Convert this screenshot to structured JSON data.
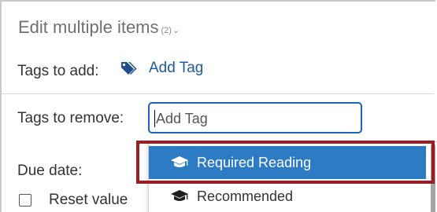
{
  "header": {
    "title": "Edit multiple items",
    "count_label": "(2)"
  },
  "tags_add": {
    "label": "Tags to add:",
    "link_label": "Add Tag",
    "icon": "tag-icon"
  },
  "tags_remove": {
    "label": "Tags to remove:",
    "input_placeholder": "Add Tag"
  },
  "dropdown": {
    "options": [
      {
        "label": "Required Reading",
        "icon": "graduation-cap-icon",
        "selected": true
      },
      {
        "label": "Recommended",
        "icon": "graduation-cap-icon",
        "selected": false
      }
    ]
  },
  "due_date": {
    "label": "Due date:",
    "reset_label": "Reset value",
    "reset_checked": false
  },
  "colors": {
    "accent": "#1e64b4",
    "selected_bg": "#2c7bc4",
    "link": "#1e5a9e",
    "highlight_border": "#9b1c25"
  }
}
